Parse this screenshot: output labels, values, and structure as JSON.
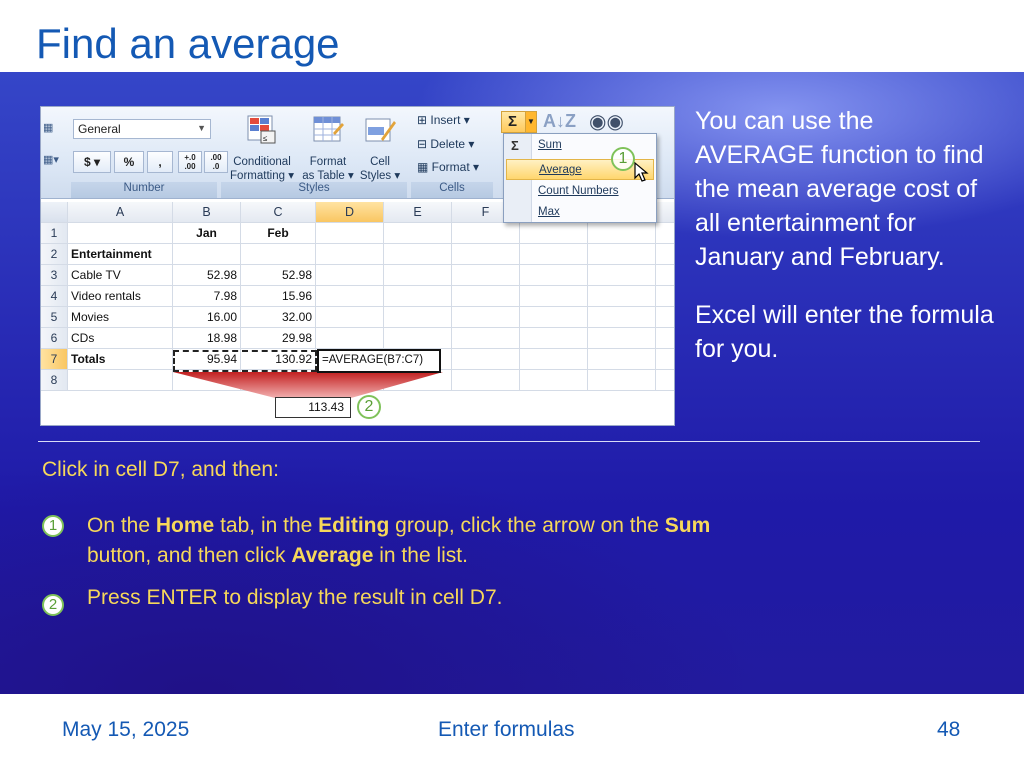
{
  "slide": {
    "title": "Find an average",
    "footer_date": "May 15, 2025",
    "footer_title": "Enter formulas",
    "page_number": "48"
  },
  "excel": {
    "number_format": "General",
    "number_buttons": [
      "$",
      "%",
      ","
    ],
    "decimal_buttons": [
      ".0→.00",
      ".00→.0"
    ],
    "groups": {
      "number": "Number",
      "styles": "Styles",
      "cells": "Cells"
    },
    "styles_buttons": [
      {
        "line1": "Conditional",
        "line2": "Formatting ▾"
      },
      {
        "line1": "Format",
        "line2": "as Table ▾"
      },
      {
        "line1": "Cell",
        "line2": "Styles ▾"
      }
    ],
    "cells_buttons": [
      "Insert ▾",
      "Delete ▾",
      "Format ▾"
    ],
    "sigma": "Σ",
    "autosum_menu": [
      "Sum",
      "Average",
      "Count Numbers",
      "Max"
    ],
    "columns": [
      "A",
      "B",
      "C",
      "D",
      "E",
      "F"
    ],
    "rows": [
      {
        "num": "1",
        "a": "",
        "b": "Jan",
        "c": "Feb"
      },
      {
        "num": "2",
        "a": "Entertainment",
        "b": "",
        "c": ""
      },
      {
        "num": "3",
        "a": "Cable TV",
        "b": "52.98",
        "c": "52.98"
      },
      {
        "num": "4",
        "a": "Video rentals",
        "b": "7.98",
        "c": "15.96"
      },
      {
        "num": "5",
        "a": "Movies",
        "b": "16.00",
        "c": "32.00"
      },
      {
        "num": "6",
        "a": "CDs",
        "b": "18.98",
        "c": "29.98"
      },
      {
        "num": "7",
        "a": "Totals",
        "b": "95.94",
        "c": "130.92"
      },
      {
        "num": "8",
        "a": "",
        "b": "",
        "c": ""
      }
    ],
    "formula": "=AVERAGE(B7:C7)",
    "result": "113.43",
    "callouts": [
      "1",
      "2"
    ]
  },
  "description": {
    "para1": "You can use the AVERAGE function to find the mean average cost of all entertainment for January and February.",
    "para2": "Excel will enter the formula for you."
  },
  "instructions": {
    "intro": "Click in cell D7, and then:",
    "step1_num": "1",
    "step1": {
      "t1": "On the ",
      "b1": "Home",
      "t2": " tab, in the ",
      "b2": "Editing",
      "t3": " group, click the arrow on the ",
      "b3": "Sum",
      "t4": " button, and then click ",
      "b4": "Average",
      "t5": " in the list."
    },
    "step2_num": "2",
    "step2": "Press ENTER to display the result in cell D7."
  },
  "colors": {
    "title": "#1459b4",
    "highlight_text": "#f7d85a",
    "callout_green": "#7fc25a"
  }
}
